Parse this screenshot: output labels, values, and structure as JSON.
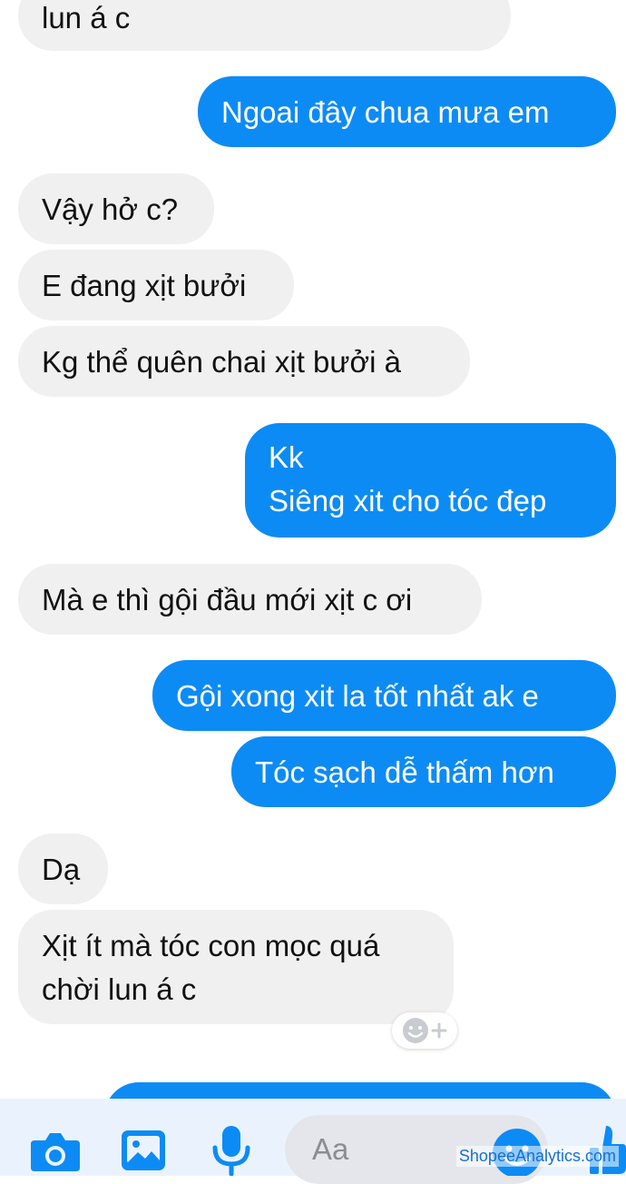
{
  "messages": [
    {
      "side": "in",
      "text": "lun á c"
    },
    {
      "side": "out",
      "text": "Ngoai đây chua mưa em"
    },
    {
      "side": "in",
      "text": "Vậy hở c?"
    },
    {
      "side": "in",
      "text": "E đang xịt bưởi"
    },
    {
      "side": "in",
      "text": "Kg thể quên chai xịt bưởi à"
    },
    {
      "side": "out",
      "text": "Kk\nSiêng xit cho tóc đẹp"
    },
    {
      "side": "in",
      "text": "Mà e thì gội đầu mới xịt c ơi"
    },
    {
      "side": "out",
      "text": "Gội xong xit la tốt nhất ak e"
    },
    {
      "side": "out",
      "text": "Tóc sạch dễ thấm hơn"
    },
    {
      "side": "in",
      "text": "Dạ"
    },
    {
      "side": "in",
      "text": "Xịt ít mà tóc con mọc quá\nchời lun á c"
    }
  ],
  "composer": {
    "placeholder": "Aa",
    "icons": [
      "camera-icon",
      "photo-icon",
      "microphone-icon",
      "emoji-icon",
      "like-icon"
    ]
  },
  "watermark": "ShopeeAnalytics.com",
  "colors": {
    "outgoing_bubble": "#0d8bf4",
    "incoming_bubble": "#f1f0f0",
    "accent": "#0d8bf4"
  }
}
